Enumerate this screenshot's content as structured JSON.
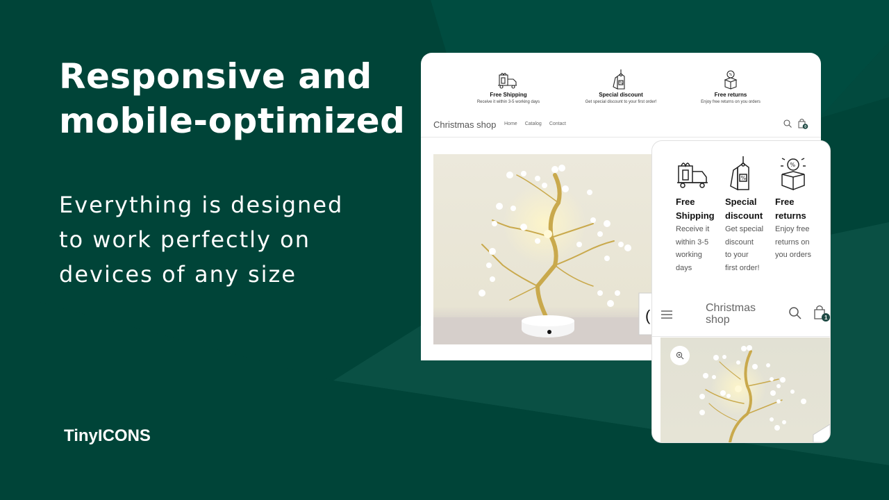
{
  "hero": {
    "headline_line1": "Responsive and",
    "headline_line2": "mobile-optimized",
    "subtitle_line1": "Everything is designed",
    "subtitle_line2": "to work perfectly on",
    "subtitle_line3": "devices of any size",
    "brand": "TinyICONS"
  },
  "colors": {
    "background": "#004438",
    "accent_light": "#0a5044",
    "accent_mid": "#024a3e",
    "text": "#ffffff",
    "badge": "#1f4a44"
  },
  "desktop_preview": {
    "features": [
      {
        "icon": "delivery-truck-gift-icon",
        "title": "Free Shipping",
        "desc": "Receive it within 3-5 working days"
      },
      {
        "icon": "discount-tag-icon",
        "title": "Special discount",
        "desc": "Get special discount to your first order!"
      },
      {
        "icon": "return-box-icon",
        "title": "Free returns",
        "desc": "Enjoy free returns on you orders"
      }
    ],
    "nav": {
      "logo": "Christmas shop",
      "links": [
        "Home",
        "Catalog",
        "Contact"
      ],
      "cart_count": "0"
    },
    "product_image": "led-bonsai-tree-lamp"
  },
  "mobile_preview": {
    "features": [
      {
        "icon": "delivery-truck-gift-icon",
        "title_lines": [
          "Free",
          "Shipping"
        ],
        "desc_lines": [
          "Receive it",
          "within 3-5",
          "working",
          "days"
        ]
      },
      {
        "icon": "discount-tag-icon",
        "title_lines": [
          "Special",
          "discount"
        ],
        "desc_lines": [
          "Get special",
          "discount",
          "to your",
          "first order!"
        ]
      },
      {
        "icon": "return-box-icon",
        "title_lines": [
          "Free",
          "returns"
        ],
        "desc_lines": [
          "Enjoy free",
          "returns on",
          "you orders"
        ]
      }
    ],
    "header": {
      "logo_line1": "Christmas",
      "logo_line2": "shop",
      "cart_count": "1"
    },
    "product_image": "led-bonsai-tree-lamp"
  }
}
